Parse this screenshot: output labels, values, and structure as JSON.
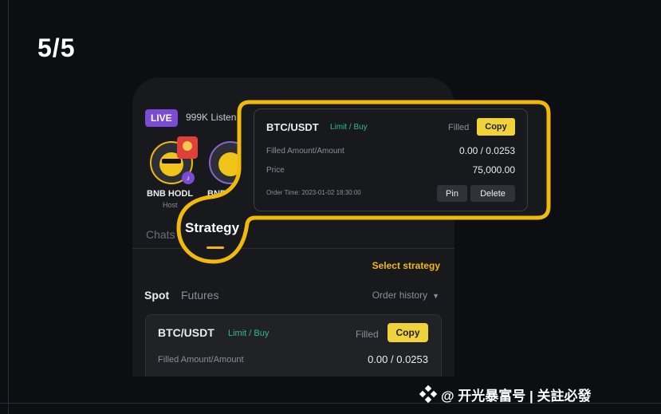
{
  "step": "5/5",
  "live_room": {
    "badge": "LIVE",
    "listeners": "999K Listen",
    "hosts": [
      {
        "name": "BNB HODL",
        "role": "Host"
      },
      {
        "name": "BNB H"
      }
    ],
    "chats_tab": "Chats",
    "strategy_tab": "Strategy",
    "select_strategy": "Select strategy",
    "market_tabs": [
      "Spot",
      "Futures"
    ],
    "order_history": "Order history",
    "order_card": {
      "pair": "BTC/USDT",
      "type": "Limit / Buy",
      "status": "Filled",
      "copy": "Copy",
      "amount_label": "Filled Amount/Amount",
      "amount_value": "0.00 / 0.0253"
    }
  },
  "zoomed_order": {
    "pair": "BTC/USDT",
    "type": "Limit / Buy",
    "status": "Filled",
    "copy": "Copy",
    "amount_label": "Filled Amount/Amount",
    "amount_value": "0.00 / 0.0253",
    "price_label": "Price",
    "price_value": "75,000.00",
    "order_time": "Order Time: 2023-01-02 18:30:00",
    "pin": "Pin",
    "delete": "Delete"
  },
  "watermark": "@ 开光暴富号 | 关註必發",
  "colors": {
    "accent": "#f0b90b",
    "copy_button": "#f0d23a",
    "buy_green": "#2ebd85",
    "live_purple": "#7b4bd6",
    "background": "#0d0e11"
  },
  "icons": [
    "red-packet-icon",
    "mic-icon",
    "caret-down-icon",
    "binance-logo-icon"
  ]
}
